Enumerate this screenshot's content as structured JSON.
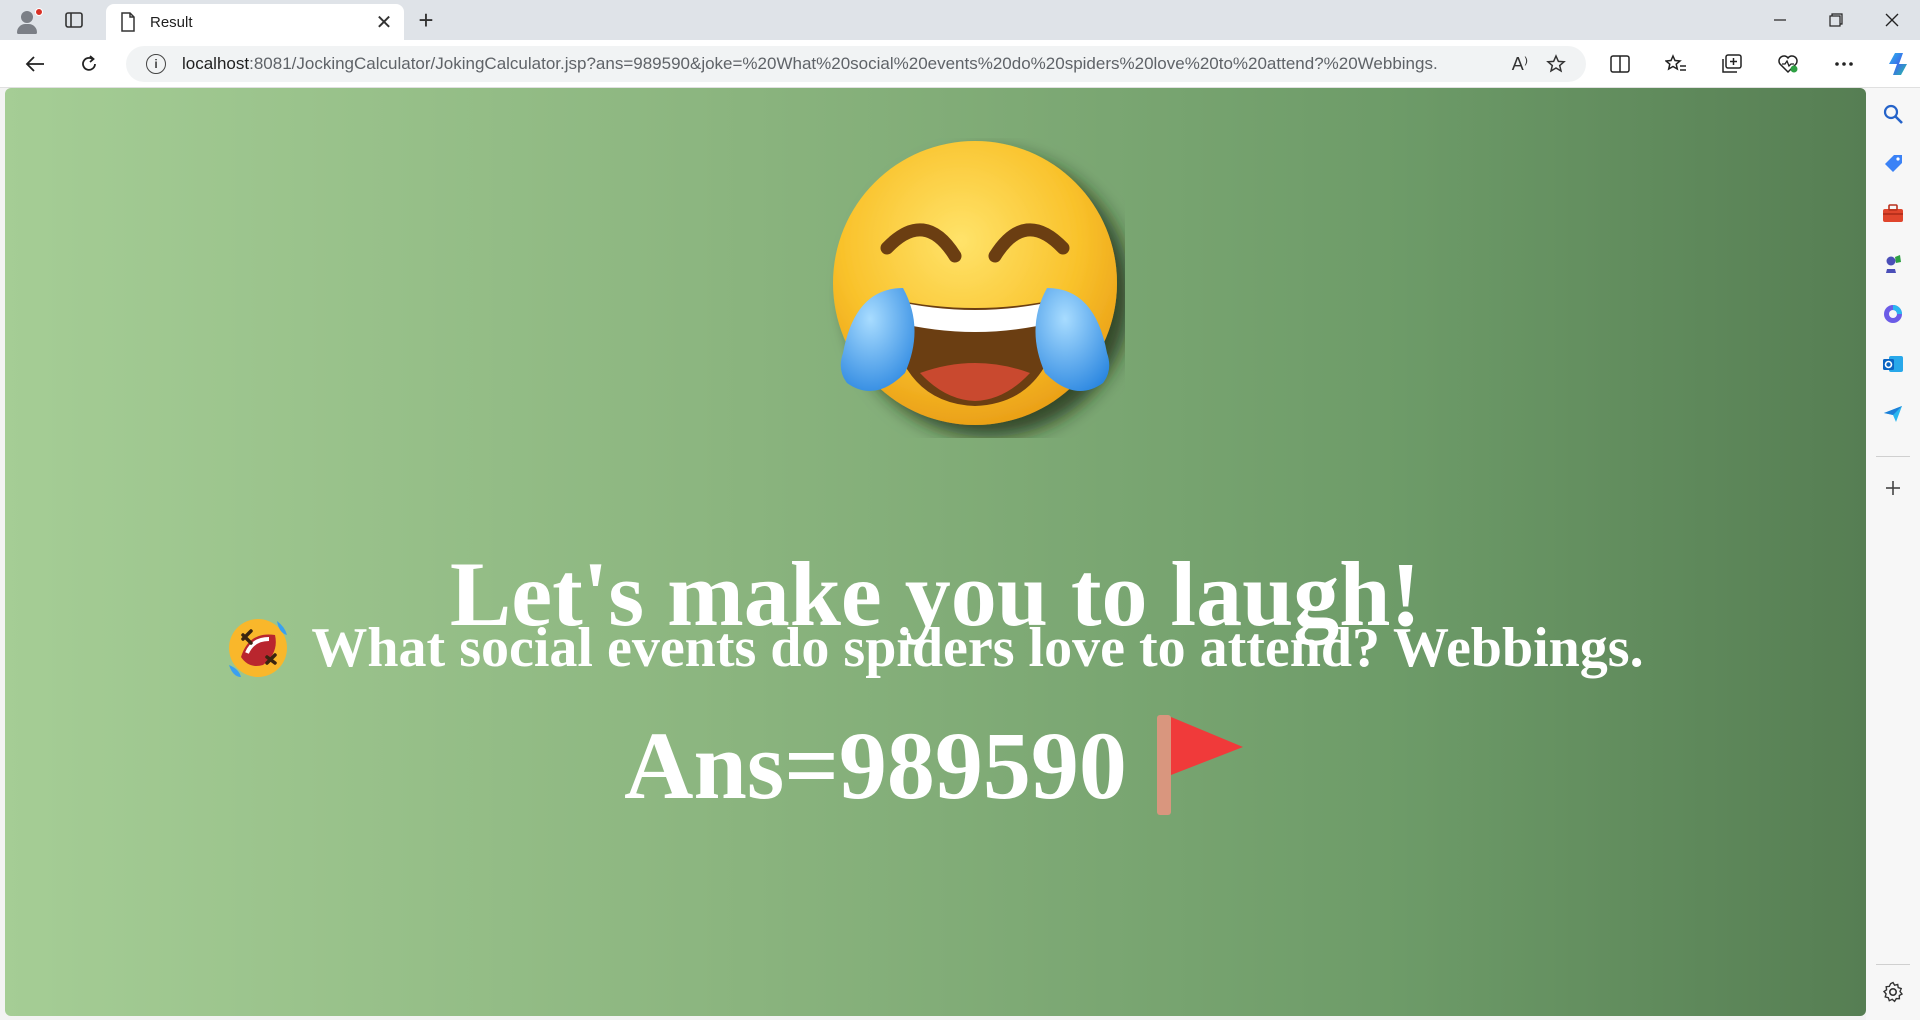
{
  "browser": {
    "tab": {
      "title": "Result",
      "close_glyph": "✕"
    },
    "new_tab_glyph": "+",
    "address": {
      "host": "localhost",
      "rest": ":8081/JockingCalculator/JokingCalculator.jsp?ans=989590&joke=%20What%20social%20events%20do%20spiders%20love%20to%20attend?%20Webbings."
    },
    "read_aloud_glyph": "A⁾"
  },
  "page": {
    "headline": "Let's make you to laugh!",
    "joke": "What social events do spiders love to attend? Webbings.",
    "answer": "Ans=989590"
  },
  "icons": {
    "big_emoji": "face-with-tears-of-joy-icon",
    "joke_emoji": "rolling-on-floor-laughing-icon",
    "answer_emoji": "red-flag-icon"
  },
  "colors": {
    "gradient_start": "#a5cd95",
    "gradient_end": "#567e53",
    "text": "#ffffff",
    "emoji_yellow": "#f9c22b",
    "tear_blue": "#3aa0f0",
    "flag_red": "#f03a3a"
  }
}
